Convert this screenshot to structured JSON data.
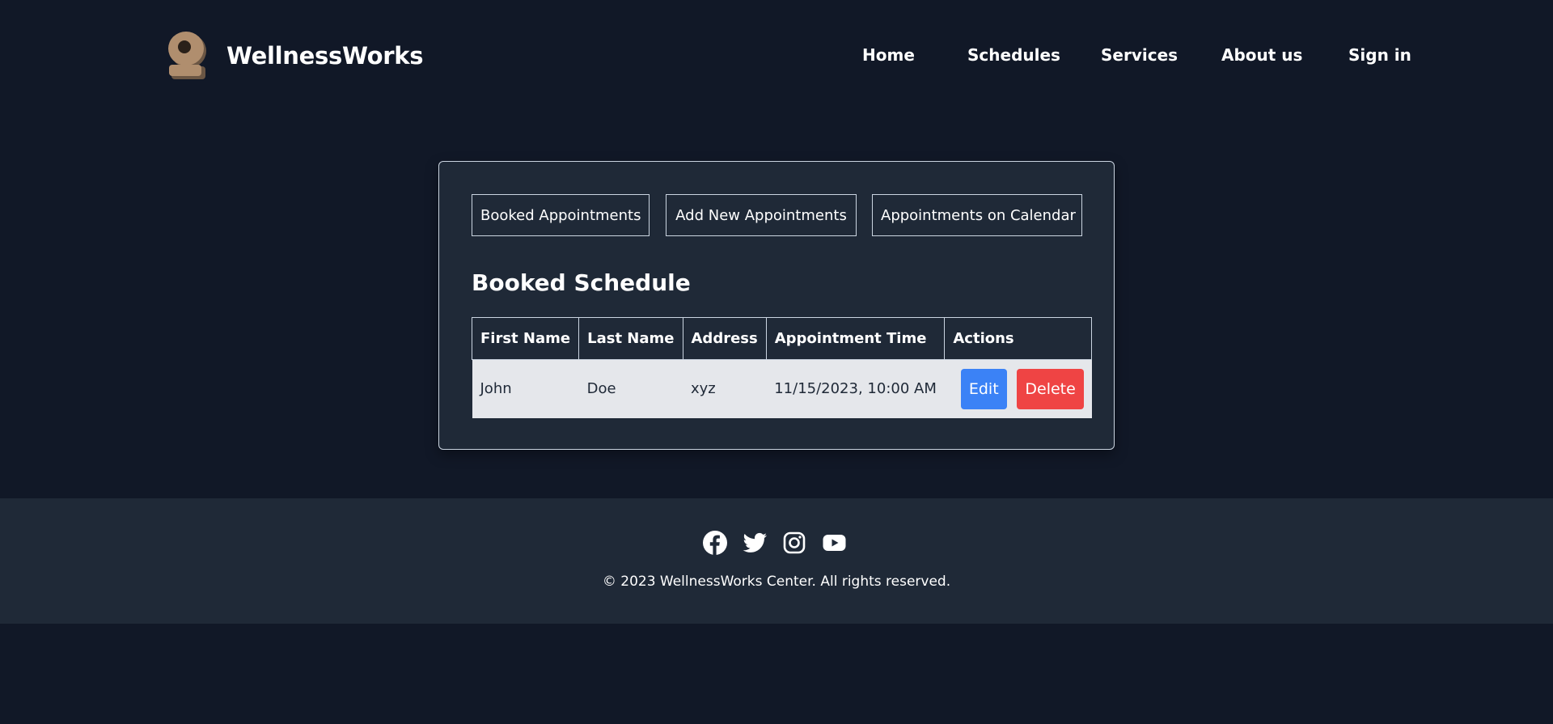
{
  "brand": {
    "name": "WellnessWorks",
    "logo_icon": "meditation-figure-icon",
    "logo_color": "#b08e6e"
  },
  "nav": {
    "items": [
      "Home",
      "Schedules",
      "Services",
      "About us",
      "Sign in"
    ]
  },
  "tabs": [
    "Booked Appointments",
    "Add New Appointments",
    "Appointments on Calendar"
  ],
  "section_title": "Booked Schedule",
  "table": {
    "headers": [
      "First Name",
      "Last Name",
      "Address",
      "Appointment Time",
      "Actions"
    ],
    "rows": [
      {
        "first_name": "John",
        "last_name": "Doe",
        "address": "xyz",
        "time": "11/15/2023, 10:00 AM",
        "edit_label": "Edit",
        "delete_label": "Delete"
      }
    ]
  },
  "colors": {
    "background": "#111827",
    "card": "#1f2937",
    "edit": "#3b82f6",
    "delete": "#ef4444",
    "row": "#e5e7eb"
  },
  "footer": {
    "social_icons": [
      "facebook-icon",
      "twitter-icon",
      "instagram-icon",
      "youtube-icon"
    ],
    "copyright": "© 2023 WellnessWorks Center. All rights reserved."
  }
}
